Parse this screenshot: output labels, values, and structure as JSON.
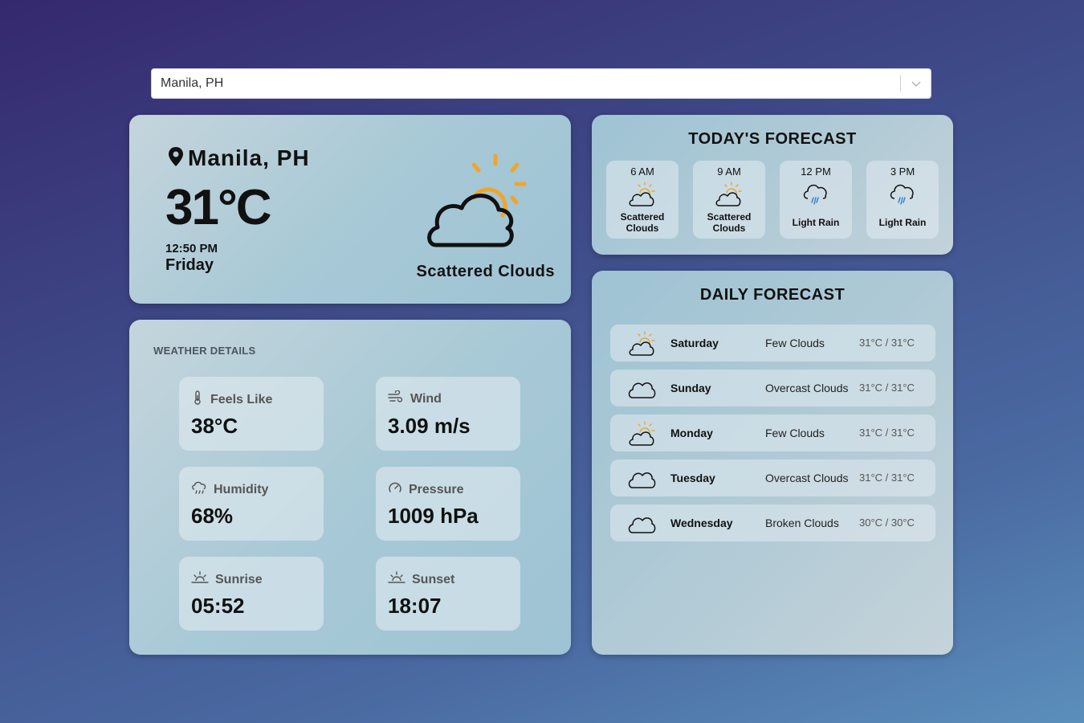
{
  "search": {
    "value": "Manila, PH"
  },
  "current": {
    "location": "Manila, PH",
    "temperature": "31°C",
    "time": "12:50 PM",
    "day": "Friday",
    "description": "Scattered Clouds",
    "icon": "partly-cloudy-icon"
  },
  "details": {
    "title": "WEATHER DETAILS",
    "items": [
      {
        "label": "Feels Like",
        "value": "38°C",
        "icon": "thermometer-icon"
      },
      {
        "label": "Wind",
        "value": "3.09 m/s",
        "icon": "wind-icon"
      },
      {
        "label": "Humidity",
        "value": "68%",
        "icon": "humidity-icon"
      },
      {
        "label": "Pressure",
        "value": "1009 hPa",
        "icon": "gauge-icon"
      },
      {
        "label": "Sunrise",
        "value": "05:52",
        "icon": "sunrise-icon"
      },
      {
        "label": "Sunset",
        "value": "18:07",
        "icon": "sunset-icon"
      }
    ]
  },
  "today": {
    "title": "TODAY'S FORECAST",
    "hours": [
      {
        "time": "6 AM",
        "desc_line1": "Scattered",
        "desc_line2": "Clouds",
        "icon": "partly-cloudy-icon"
      },
      {
        "time": "9 AM",
        "desc_line1": "Scattered",
        "desc_line2": "Clouds",
        "icon": "partly-cloudy-icon"
      },
      {
        "time": "12 PM",
        "desc_line1": "Light Rain",
        "desc_line2": "",
        "icon": "rain-icon"
      },
      {
        "time": "3 PM",
        "desc_line1": "Light Rain",
        "desc_line2": "",
        "icon": "rain-icon"
      }
    ]
  },
  "daily": {
    "title": "DAILY FORECAST",
    "days": [
      {
        "day": "Saturday",
        "desc": "Few Clouds",
        "temp": "31°C / 31°C",
        "icon": "partly-cloudy-icon"
      },
      {
        "day": "Sunday",
        "desc": "Overcast Clouds",
        "temp": "31°C / 31°C",
        "icon": "cloud-icon"
      },
      {
        "day": "Monday",
        "desc": "Few Clouds",
        "temp": "31°C / 31°C",
        "icon": "partly-cloudy-icon"
      },
      {
        "day": "Tuesday",
        "desc": "Overcast Clouds",
        "temp": "31°C / 31°C",
        "icon": "cloud-icon"
      },
      {
        "day": "Wednesday",
        "desc": "Broken Clouds",
        "temp": "30°C / 30°C",
        "icon": "cloud-icon"
      }
    ]
  },
  "colors": {
    "sun": "#f0a52a",
    "rain": "#2e7fc8",
    "text": "#111111"
  }
}
